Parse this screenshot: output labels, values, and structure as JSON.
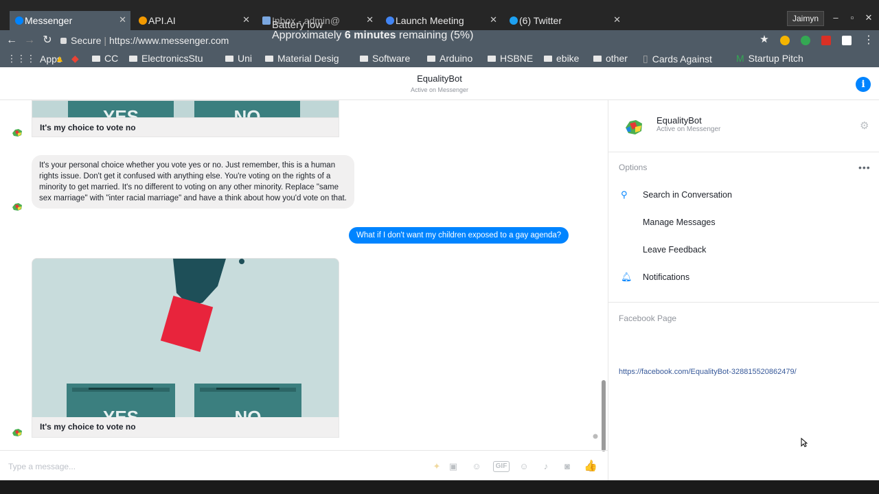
{
  "browser": {
    "tabs": [
      {
        "label": "Messenger",
        "color": "#0084ff"
      },
      {
        "label": "API.AI",
        "color": "#f29900"
      },
      {
        "label": "Inbox - admin@",
        "color": "#7aa7e0"
      },
      {
        "label": "Launch Meeting",
        "color": "#4285f4"
      },
      {
        "label": "(6) Twitter",
        "color": "#1da1f2"
      }
    ],
    "user": "Jaimyn",
    "url_secure": "Secure",
    "url": "https://www.messenger.com",
    "bookmarks": [
      "Apps",
      "CC",
      "ElectronicsStu",
      "Uni",
      "Material Desig",
      "Software",
      "Arduino",
      "HSBNE",
      "ebike",
      "other",
      "Cards Against",
      "Startup Pitch"
    ]
  },
  "notification": {
    "title": "Battery low",
    "message_prefix": "Approximately ",
    "message_bold": "6 minutes",
    "message_suffix": " remaining (5%)"
  },
  "header": {
    "name": "EqualityBot",
    "status": "Active on Messenger",
    "info_icon": "i"
  },
  "messages": {
    "caption_1": "It's my choice to vote no",
    "reply_1": "It's your personal choice whether you vote yes or no. Just remember, this is a human rights issue. Don't get it confused with anything else. You're voting on the rights of a minority to get married. It's no different to voting on any other minority. Replace \"same sex marriage\" with \"inter racial marriage\" and have a think about how you'd vote on that.",
    "sent_1": "What if I don't want my children exposed to a gay agenda?",
    "caption_2": "It's my choice to vote no",
    "box_yes": "YES",
    "box_no": "NO"
  },
  "composer": {
    "placeholder": "Type a message..."
  },
  "right_pane": {
    "name": "EqualityBot",
    "status": "Active on Messenger",
    "options_title": "Options",
    "options": [
      "Search in Conversation",
      "Manage Messages",
      "Leave Feedback",
      "Notifications"
    ],
    "fb_title": "Facebook Page",
    "fb_link": "https://facebook.com/EqualityBot-328815520862479/"
  }
}
